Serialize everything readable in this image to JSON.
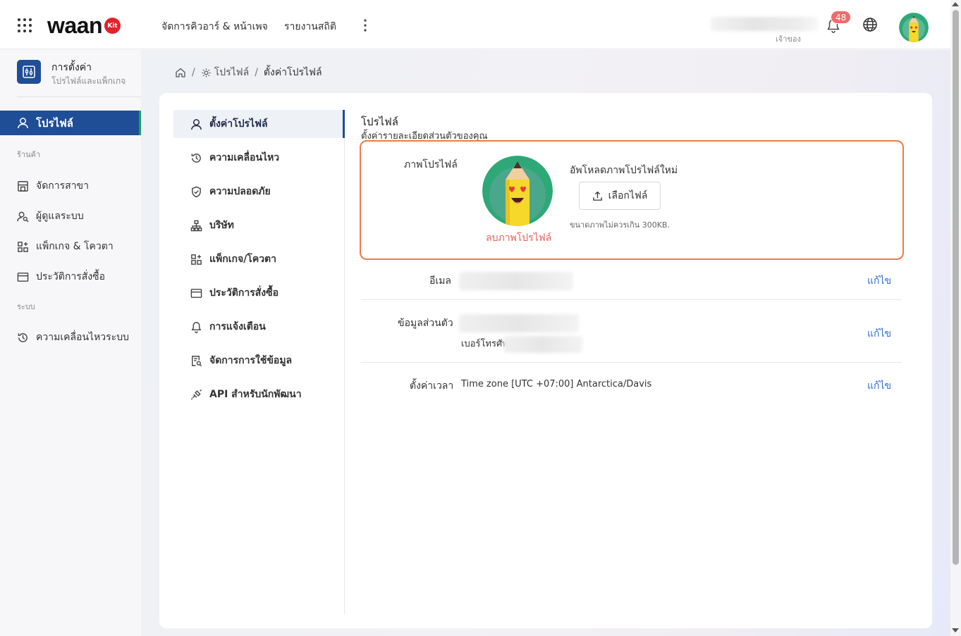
{
  "header": {
    "logo_text": "waan",
    "logo_badge": "Kit",
    "nav": [
      {
        "label": "จัดการคิวอาร์ & หน้าเพจ"
      },
      {
        "label": "รายงานสถิติ"
      }
    ],
    "user_role": "เจ้าของ",
    "notification_count": "48",
    "icons": [
      "apps-grid-icon",
      "more-vertical-icon",
      "bell-icon",
      "globe-icon"
    ]
  },
  "sidebar": {
    "settings_title": "การตั้งค่า",
    "settings_subtitle": "โปรไฟล์และแพ็กเกจ",
    "active_item": "โปรไฟล์",
    "section_store": "ร้านค้า",
    "store_items": [
      {
        "label": "จัดการสาขา",
        "icon": "store-icon"
      },
      {
        "label": "ผู้ดูแลระบบ",
        "icon": "users-icon"
      },
      {
        "label": "แพ็กเกจ & โควตา",
        "icon": "package-icon"
      },
      {
        "label": "ประวัติการสั่งซื้อ",
        "icon": "credit-card-icon"
      }
    ],
    "section_system": "ระบบ",
    "system_items": [
      {
        "label": "ความเคลื่อนไหวระบบ",
        "icon": "history-icon"
      }
    ]
  },
  "breadcrumb": {
    "parent": "โปรไฟล์",
    "current": "ตั้งค่าโปรไฟล์"
  },
  "inner_menu": [
    {
      "label": "ตั้งค่าโปรไฟล์",
      "icon": "user-icon"
    },
    {
      "label": "ความเคลื่อนไหว",
      "icon": "history-icon"
    },
    {
      "label": "ความปลอดภัย",
      "icon": "shield-icon"
    },
    {
      "label": "บริษัท",
      "icon": "sitemap-icon"
    },
    {
      "label": "แพ็กเกจ/โควตา",
      "icon": "package-icon"
    },
    {
      "label": "ประวัติการสั่งซื้อ",
      "icon": "credit-card-icon"
    },
    {
      "label": "การแจ้งเตือน",
      "icon": "bell-icon"
    },
    {
      "label": "จัดการการใช้ข้อมูล",
      "icon": "data-usage-icon"
    },
    {
      "label": "API สำหรับนักพัฒนา",
      "icon": "api-icon"
    }
  ],
  "profile": {
    "title": "โปรไฟล์",
    "subtitle": "ตั้งค่ารายละเอียดส่วนตัวของคุณ",
    "photo_label": "ภาพโปรไฟล์",
    "delete_photo": "ลบภาพโปรไฟล์",
    "upload_title": "อัพโหลดภาพโปรไฟล์ใหม่",
    "choose_file": "เลือกไฟล์",
    "upload_hint": "ขนาดภาพไม่ควรเกิน 300KB.",
    "email_label": "อีเมล",
    "personal_label": "ข้อมูลส่วนตัว",
    "phone_label": "เบอร์โทรศัพ",
    "timezone_label": "ตั้งค่าเวลา",
    "timezone_value": "Time zone [UTC +07:00] Antarctica/Davis",
    "edit_label": "แก้ไข"
  },
  "colors": {
    "primary": "#1f4e96",
    "accent_green": "#1e9e5e",
    "highlight_border": "#ef7a45",
    "delete_text": "#e0615c",
    "link": "#2f6fd0",
    "badge": "#f06b6b"
  }
}
